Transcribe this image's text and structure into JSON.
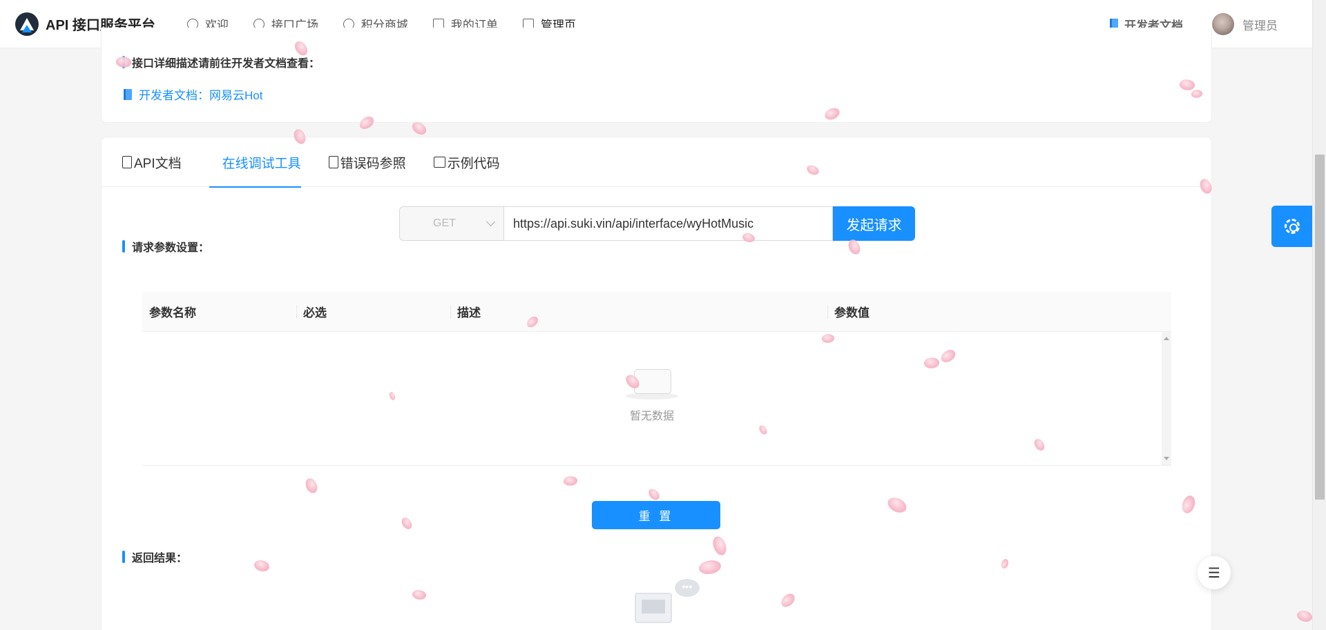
{
  "header": {
    "brand": "API 接口服务平台",
    "nav": [
      {
        "label": "欢迎",
        "icon": "smile-icon"
      },
      {
        "label": "接口广场",
        "icon": "reddit-icon"
      },
      {
        "label": "积分商城",
        "icon": "yen-icon"
      },
      {
        "label": "我的订单",
        "icon": "order-icon"
      },
      {
        "label": "管理页",
        "icon": "crown-icon"
      }
    ],
    "doc_link": "开发者文档",
    "user_name": "管理员"
  },
  "top_card": {
    "hint": "接口详细描述请前往开发者文档查看：",
    "dev_doc_link": "开发者文档：网易云Hot"
  },
  "tabs": [
    {
      "label": "API文档",
      "icon": "file-icon",
      "active": false
    },
    {
      "label": "在线调试工具",
      "icon": "tool-icon",
      "active": true
    },
    {
      "label": "错误码参照",
      "icon": "file-error-icon",
      "active": false
    },
    {
      "label": "示例代码",
      "icon": "terminal-icon",
      "active": false
    }
  ],
  "request": {
    "method": "GET",
    "url": "https://api.suki.vin/api/interface/wyHotMusic",
    "send_label": "发起请求"
  },
  "params": {
    "title": "请求参数设置：",
    "columns": [
      "参数名称",
      "必选",
      "描述",
      "参数值"
    ],
    "rows": [],
    "empty_text": "暂无数据"
  },
  "reset_label": "重 置",
  "result": {
    "title": "返回结果："
  },
  "colors": {
    "primary": "#1890ff"
  }
}
